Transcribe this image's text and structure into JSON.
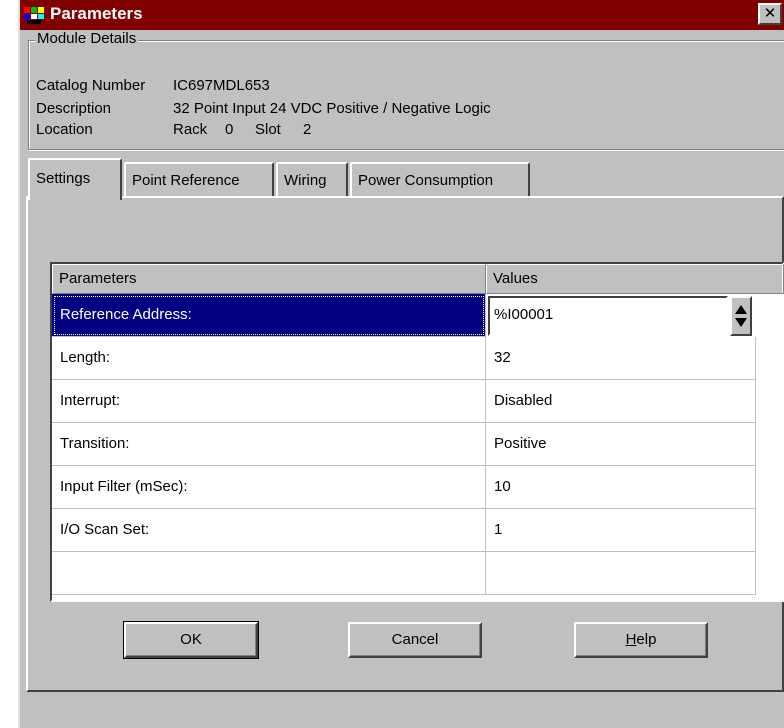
{
  "window": {
    "title": "Parameters",
    "close_label": "✕"
  },
  "module_details": {
    "group_label": "Module Details",
    "catalog_label": "Catalog Number",
    "catalog_value": "IC697MDL653",
    "description_label": "Description",
    "description_value": "32 Point Input 24 VDC Positive / Negative Logic",
    "location_label": "Location",
    "rack_label": "Rack",
    "rack_value": "0",
    "slot_label": "Slot",
    "slot_value": "2"
  },
  "tabs": [
    {
      "label": "Settings",
      "active": true
    },
    {
      "label": "Point Reference",
      "active": false
    },
    {
      "label": "Wiring",
      "active": false
    },
    {
      "label": "Power Consumption",
      "active": false
    }
  ],
  "grid": {
    "col_parameters": "Parameters",
    "col_values": "Values",
    "rows": [
      {
        "param": "Reference Address:",
        "value": "%I00001"
      },
      {
        "param": "Length:",
        "value": "32"
      },
      {
        "param": "Interrupt:",
        "value": "Disabled"
      },
      {
        "param": "Transition:",
        "value": "Positive"
      },
      {
        "param": "Input Filter (mSec):",
        "value": "10"
      },
      {
        "param": "I/O Scan Set:",
        "value": "1"
      }
    ]
  },
  "buttons": {
    "ok": "OK",
    "cancel": "Cancel",
    "help": "Help"
  },
  "colors": {
    "titlebar": "#800000",
    "selection": "#000080",
    "face": "#c0c0c0"
  },
  "icons": {
    "app": "parameters-app-icon",
    "close": "close-icon",
    "spinner": "spinner-arrows-icon"
  }
}
